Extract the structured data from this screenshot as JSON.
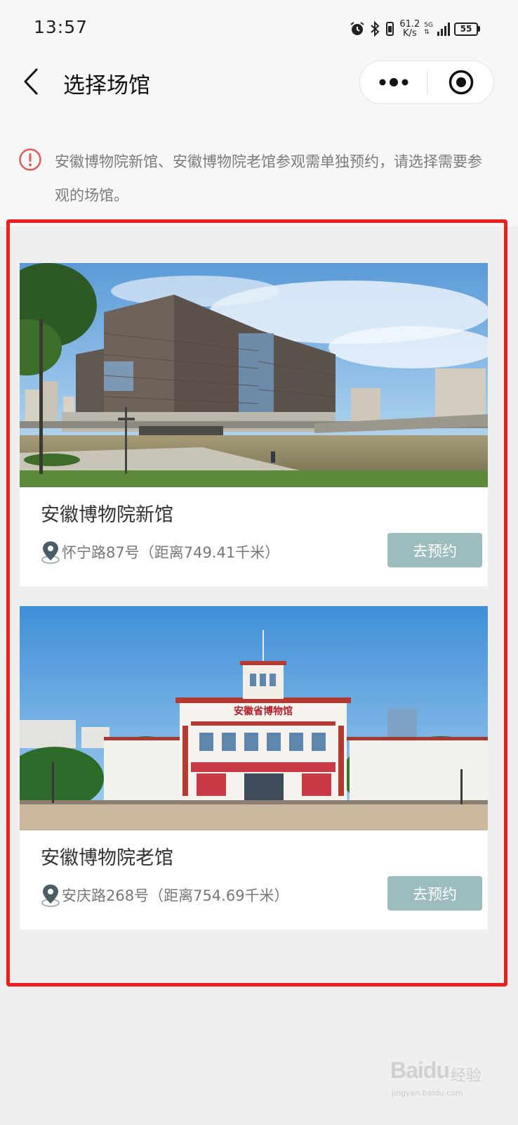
{
  "status_bar": {
    "time": "13:57",
    "speed_value": "61.2",
    "speed_unit": "K/s",
    "network": "5G",
    "battery": "55"
  },
  "nav": {
    "title": "选择场馆"
  },
  "notice": {
    "text": "安徽博物院新馆、安徽博物院老馆参观需单独预约，请选择需要参观的场馆。"
  },
  "venues": [
    {
      "name": "安徽博物院新馆",
      "address": "怀宁路87号（距离749.41千米）",
      "button": "去预约"
    },
    {
      "name": "安徽博物院老馆",
      "address": "安庆路268号（距离754.69千米）",
      "button": "去预约"
    }
  ],
  "photo_sign": "安徽省博物馆",
  "watermark": {
    "brand": "Baidu",
    "label": "经验",
    "url": "jingyan.baidu.com"
  },
  "colors": {
    "button": "#9cbcbe",
    "highlight": "#f01d1d",
    "notice_icon": "#e05a5a"
  }
}
